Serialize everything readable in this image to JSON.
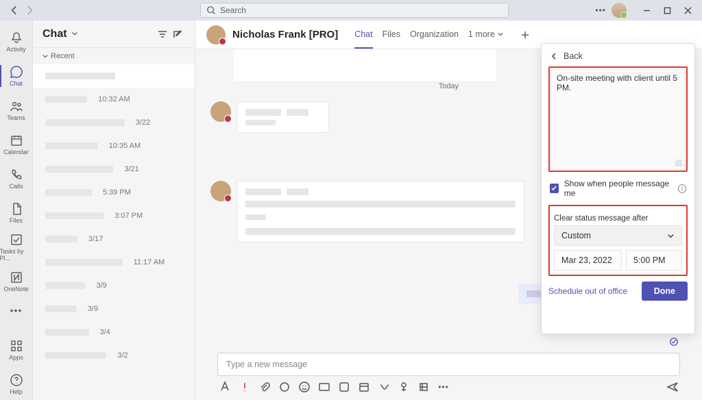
{
  "titlebar": {
    "search_placeholder": "Search"
  },
  "rail": {
    "items": [
      {
        "label": "Activity",
        "icon": "bell"
      },
      {
        "label": "Chat",
        "icon": "chat"
      },
      {
        "label": "Teams",
        "icon": "teams"
      },
      {
        "label": "Calendar",
        "icon": "calendar"
      },
      {
        "label": "Calls",
        "icon": "call"
      },
      {
        "label": "Files",
        "icon": "file"
      },
      {
        "label": "Tasks by Pl...",
        "icon": "tasks"
      },
      {
        "label": "OneNote",
        "icon": "onenote"
      }
    ],
    "tail": [
      {
        "label": "Apps",
        "icon": "apps"
      },
      {
        "label": "Help",
        "icon": "help"
      }
    ]
  },
  "panel": {
    "title": "Chat",
    "section": "Recent",
    "rows": [
      {
        "time": ""
      },
      {
        "time": "10:32 AM"
      },
      {
        "time": "3/22"
      },
      {
        "time": "10:35 AM"
      },
      {
        "time": "3/21"
      },
      {
        "time": "5:39 PM"
      },
      {
        "time": "3:07 PM"
      },
      {
        "time": "3/17"
      },
      {
        "time": "11:17 AM"
      },
      {
        "time": "3/9"
      },
      {
        "time": "3/9"
      },
      {
        "time": "3/4"
      },
      {
        "time": "3/2"
      }
    ]
  },
  "conversation": {
    "name": "Nicholas Frank [PRO]",
    "tabs": [
      "Chat",
      "Files",
      "Organization",
      "1 more"
    ],
    "day": "Today",
    "compose_placeholder": "Type a new message"
  },
  "status_panel": {
    "back": "Back",
    "message": "On-site meeting with client until 5 PM.",
    "show_when_label": "Show when people message me",
    "clear_label": "Clear status message after",
    "clear_option": "Custom",
    "clear_date": "Mar 23, 2022",
    "clear_time": "5:00 PM",
    "ooo_link": "Schedule out of office",
    "done": "Done"
  }
}
